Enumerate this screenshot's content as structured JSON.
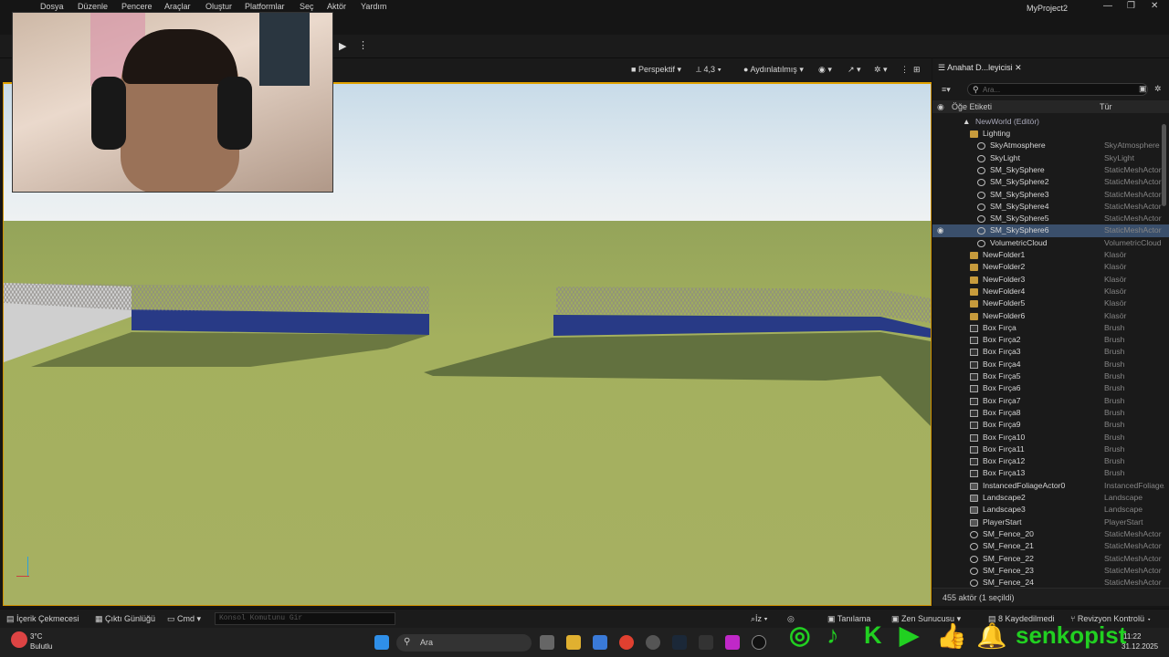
{
  "menu": {
    "items": [
      "Dosya",
      "Düzenle",
      "Pencere",
      "Araçlar",
      "Oluştur",
      "Platformlar",
      "Seç",
      "Aktör",
      "Yardım"
    ],
    "project_name": "MyProject2"
  },
  "viewport_bar": {
    "perspective": "Perspektif",
    "fov": "4,3",
    "lighting": "Aydınlatılmış"
  },
  "outliner": {
    "tab_label": "Anahat D...leyicisi",
    "search_placeholder": "Ara...",
    "col_label": "Öğe Etiketi",
    "col_type": "Tür",
    "world": "NewWorld (Editör)",
    "rows": [
      {
        "name": "Lighting",
        "type": "",
        "icon": "folder",
        "indent": 1
      },
      {
        "name": "SkyAtmosphere",
        "type": "SkyAtmosphere",
        "icon": "mesh",
        "indent": 2
      },
      {
        "name": "SkyLight",
        "type": "SkyLight",
        "icon": "mesh",
        "indent": 2
      },
      {
        "name": "SM_SkySphere",
        "type": "StaticMeshActor",
        "icon": "mesh",
        "indent": 2
      },
      {
        "name": "SM_SkySphere2",
        "type": "StaticMeshActor",
        "icon": "mesh",
        "indent": 2
      },
      {
        "name": "SM_SkySphere3",
        "type": "StaticMeshActor",
        "icon": "mesh",
        "indent": 2
      },
      {
        "name": "SM_SkySphere4",
        "type": "StaticMeshActor",
        "icon": "mesh",
        "indent": 2
      },
      {
        "name": "SM_SkySphere5",
        "type": "StaticMeshActor",
        "icon": "mesh",
        "indent": 2
      },
      {
        "name": "SM_SkySphere6",
        "type": "StaticMeshActor",
        "icon": "mesh",
        "indent": 2,
        "selected": true
      },
      {
        "name": "VolumetricCloud",
        "type": "VolumetricCloud",
        "icon": "mesh",
        "indent": 2
      },
      {
        "name": "NewFolder1",
        "type": "Klasör",
        "icon": "folder",
        "indent": 1
      },
      {
        "name": "NewFolder2",
        "type": "Klasör",
        "icon": "folder",
        "indent": 1
      },
      {
        "name": "NewFolder3",
        "type": "Klasör",
        "icon": "folder",
        "indent": 1
      },
      {
        "name": "NewFolder4",
        "type": "Klasör",
        "icon": "folder",
        "indent": 1
      },
      {
        "name": "NewFolder5",
        "type": "Klasör",
        "icon": "folder",
        "indent": 1
      },
      {
        "name": "NewFolder6",
        "type": "Klasör",
        "icon": "folder",
        "indent": 1
      },
      {
        "name": "Box Fırça",
        "type": "Brush",
        "icon": "box",
        "indent": 1
      },
      {
        "name": "Box Fırça2",
        "type": "Brush",
        "icon": "box",
        "indent": 1
      },
      {
        "name": "Box Fırça3",
        "type": "Brush",
        "icon": "box",
        "indent": 1
      },
      {
        "name": "Box Fırça4",
        "type": "Brush",
        "icon": "box",
        "indent": 1
      },
      {
        "name": "Box Fırça5",
        "type": "Brush",
        "icon": "box",
        "indent": 1
      },
      {
        "name": "Box Fırça6",
        "type": "Brush",
        "icon": "box",
        "indent": 1
      },
      {
        "name": "Box Fırça7",
        "type": "Brush",
        "icon": "box",
        "indent": 1
      },
      {
        "name": "Box Fırça8",
        "type": "Brush",
        "icon": "box",
        "indent": 1
      },
      {
        "name": "Box Fırça9",
        "type": "Brush",
        "icon": "box",
        "indent": 1
      },
      {
        "name": "Box Fırça10",
        "type": "Brush",
        "icon": "box",
        "indent": 1
      },
      {
        "name": "Box Fırça11",
        "type": "Brush",
        "icon": "box",
        "indent": 1
      },
      {
        "name": "Box Fırça12",
        "type": "Brush",
        "icon": "box",
        "indent": 1
      },
      {
        "name": "Box Fırça13",
        "type": "Brush",
        "icon": "box",
        "indent": 1
      },
      {
        "name": "InstancedFoliageActor0",
        "type": "InstancedFoliageActor",
        "icon": "gen",
        "indent": 1
      },
      {
        "name": "Landscape2",
        "type": "Landscape",
        "icon": "gen",
        "indent": 1
      },
      {
        "name": "Landscape3",
        "type": "Landscape",
        "icon": "gen",
        "indent": 1
      },
      {
        "name": "PlayerStart",
        "type": "PlayerStart",
        "icon": "gen",
        "indent": 1
      },
      {
        "name": "SM_Fence_20",
        "type": "StaticMeshActor",
        "icon": "mesh",
        "indent": 1
      },
      {
        "name": "SM_Fence_21",
        "type": "StaticMeshActor",
        "icon": "mesh",
        "indent": 1
      },
      {
        "name": "SM_Fence_22",
        "type": "StaticMeshActor",
        "icon": "mesh",
        "indent": 1
      },
      {
        "name": "SM_Fence_23",
        "type": "StaticMeshActor",
        "icon": "mesh",
        "indent": 1
      },
      {
        "name": "SM_Fence_24",
        "type": "StaticMeshActor",
        "icon": "mesh",
        "indent": 1
      }
    ],
    "footer": "455 aktör (1 seçildi)"
  },
  "statusbar": {
    "content_drawer": "İçerik Çekmecesi",
    "output_log": "Çıktı Günlüğü",
    "cmd": "Cmd",
    "cmd_placeholder": "Konsol Komutunu Gir",
    "trace": "İz",
    "derive": "Tanılama",
    "zen": "Zen Sunucusu",
    "unsaved": "8 Kaydedilmedi",
    "revision": "Revizyon Kontrolü"
  },
  "taskbar": {
    "weather_temp": "3°C",
    "weather_desc": "Bulutlu",
    "search": "Ara",
    "time": "11:22",
    "date": "31.12.2025"
  },
  "overlay": {
    "brand": "senkopist"
  },
  "colors": {
    "accent": "#e1a200",
    "selected_row": "#3a4f6b",
    "social_green": "#21d021"
  }
}
